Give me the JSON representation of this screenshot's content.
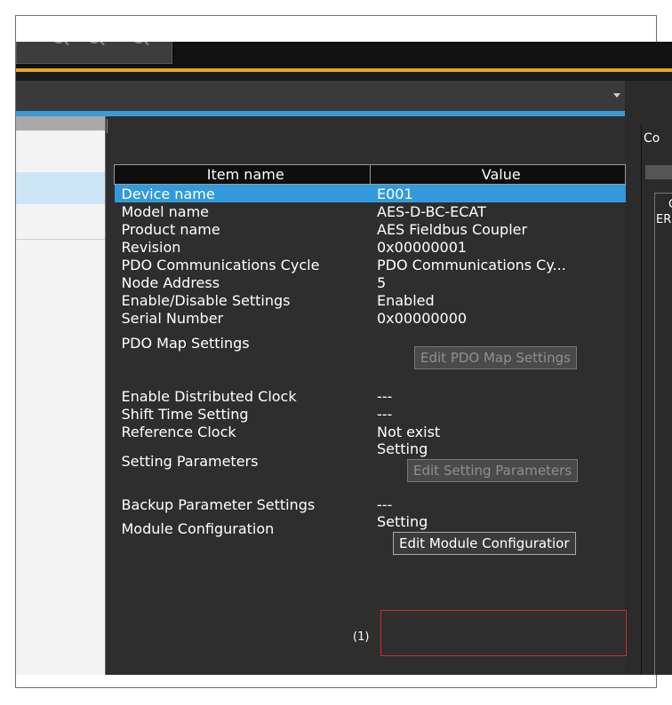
{
  "right_pane": {
    "title": "Co",
    "col_letter": "C",
    "row_label": "ER"
  },
  "table": {
    "headers": [
      "Item name",
      "Value"
    ],
    "rows": [
      {
        "name": "Device name",
        "value": "E001"
      },
      {
        "name": "Model name",
        "value": "AES-D-BC-ECAT"
      },
      {
        "name": "Product name",
        "value": "AES Fieldbus Coupler"
      },
      {
        "name": "Revision",
        "value": "0x00000001"
      },
      {
        "name": "PDO Communications Cycle",
        "value": "PDO Communications Cy..."
      },
      {
        "name": "Node Address",
        "value": "5"
      },
      {
        "name": "Enable/Disable Settings",
        "value": "Enabled"
      },
      {
        "name": "Serial Number",
        "value": "0x00000000"
      },
      {
        "name": "PDO Map Settings",
        "button": "Edit PDO Map Settings"
      },
      {
        "name": "Enable Distributed Clock",
        "value": "---"
      },
      {
        "name": "Shift Time Setting",
        "value": "---"
      },
      {
        "name": "Reference Clock",
        "value": "Not exist"
      },
      {
        "name": "Setting Parameters",
        "value": "Setting",
        "button": "Edit Setting Parameters"
      },
      {
        "name": "Backup Parameter Settings",
        "value": "---"
      },
      {
        "name": "Module Configuration",
        "value": "Setting",
        "button": "Edit Module Configuratior"
      }
    ]
  },
  "annotation": {
    "label": "(1)"
  },
  "colors": {
    "selection": "#3399dd",
    "accent": "#e8a81c",
    "highlight_box": "#d9252b"
  },
  "icons": {
    "dropdown": "chevron-down-icon",
    "search": "search-icon"
  }
}
